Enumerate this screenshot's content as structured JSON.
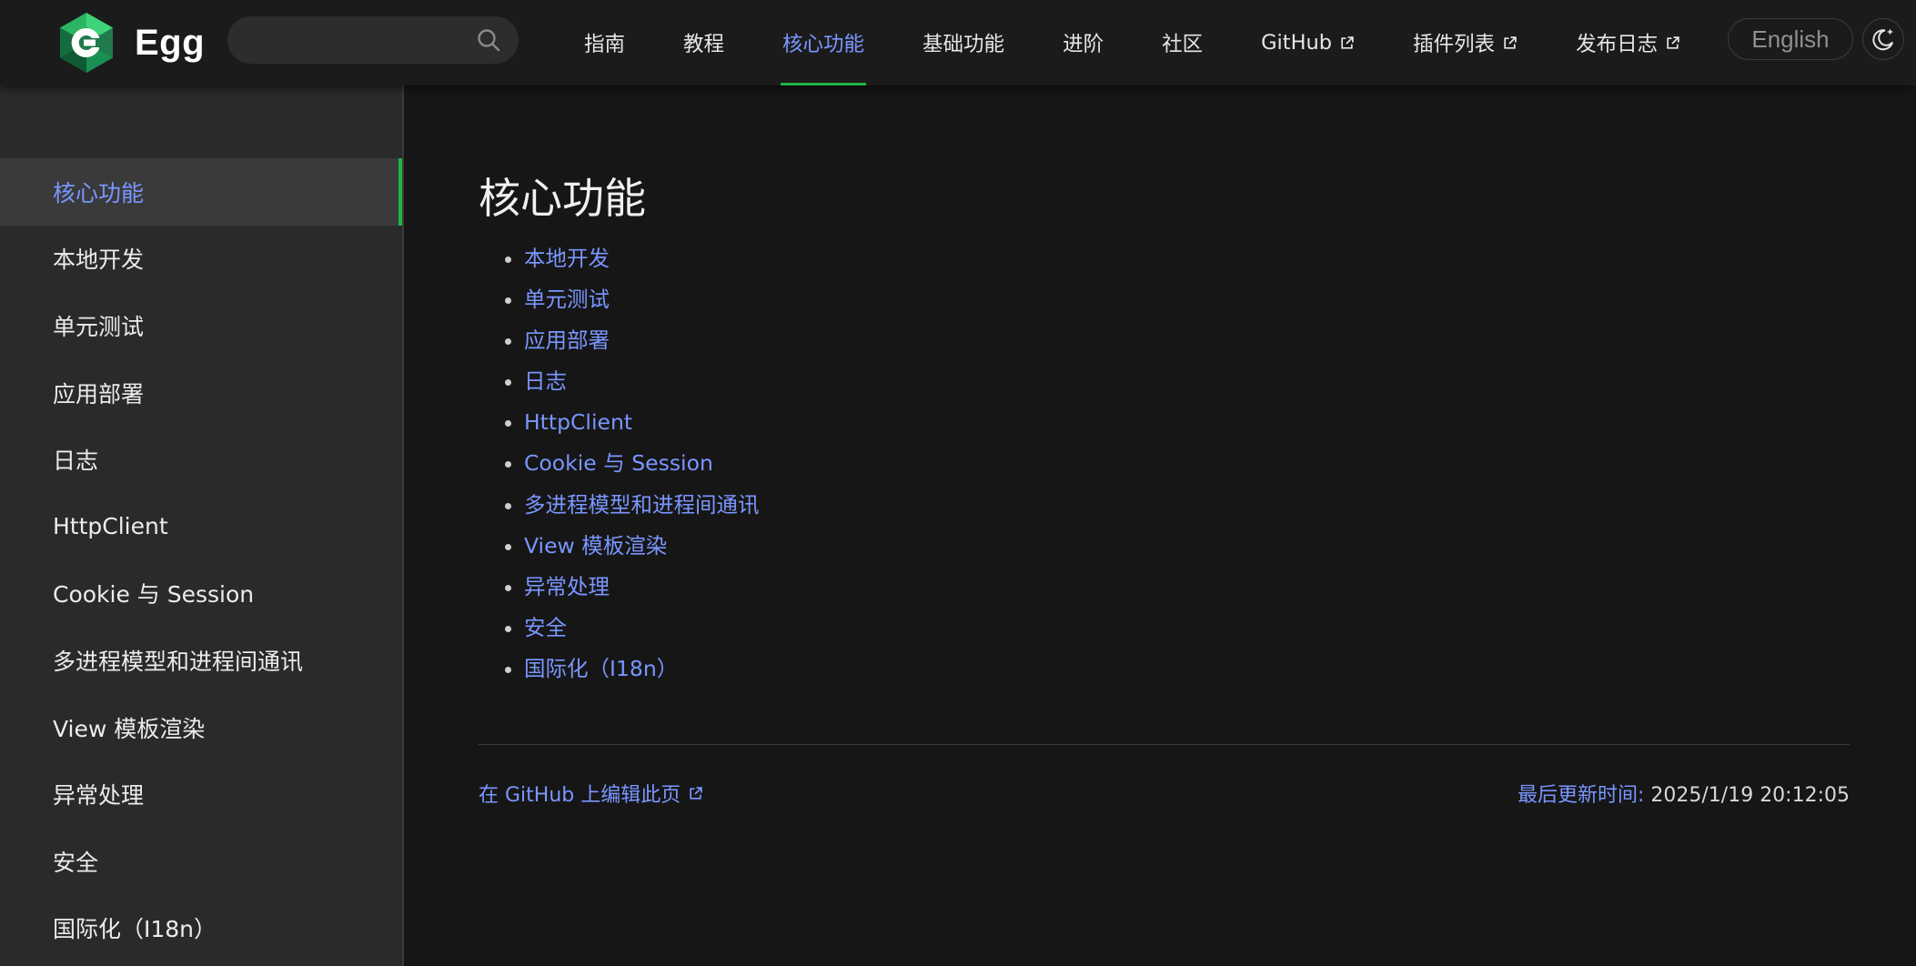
{
  "brand": {
    "name": "Egg"
  },
  "search": {
    "placeholder": ""
  },
  "nav": {
    "items": [
      {
        "label": "指南",
        "external": false,
        "active": false
      },
      {
        "label": "教程",
        "external": false,
        "active": false
      },
      {
        "label": "核心功能",
        "external": false,
        "active": true
      },
      {
        "label": "基础功能",
        "external": false,
        "active": false
      },
      {
        "label": "进阶",
        "external": false,
        "active": false
      },
      {
        "label": "社区",
        "external": false,
        "active": false
      },
      {
        "label": "GitHub",
        "external": true,
        "active": false
      },
      {
        "label": "插件列表",
        "external": true,
        "active": false
      },
      {
        "label": "发布日志",
        "external": true,
        "active": false
      }
    ],
    "language_label": "English"
  },
  "sidebar": {
    "items": [
      {
        "label": "核心功能",
        "active": true
      },
      {
        "label": "本地开发",
        "active": false
      },
      {
        "label": "单元测试",
        "active": false
      },
      {
        "label": "应用部署",
        "active": false
      },
      {
        "label": "日志",
        "active": false
      },
      {
        "label": "HttpClient",
        "active": false
      },
      {
        "label": "Cookie 与 Session",
        "active": false
      },
      {
        "label": "多进程模型和进程间通讯",
        "active": false
      },
      {
        "label": "View 模板渲染",
        "active": false
      },
      {
        "label": "异常处理",
        "active": false
      },
      {
        "label": "安全",
        "active": false
      },
      {
        "label": "国际化（I18n）",
        "active": false
      }
    ]
  },
  "main": {
    "title": "核心功能",
    "toc": [
      "本地开发",
      "单元测试",
      "应用部署",
      "日志",
      "HttpClient",
      "Cookie 与 Session",
      "多进程模型和进程间通讯",
      "View 模板渲染",
      "异常处理",
      "安全",
      "国际化（I18n）"
    ],
    "edit_link": "在 GitHub 上编辑此页",
    "last_updated_label": "最后更新时间:",
    "last_updated_value": "2025/1/19 20:12:05"
  },
  "colors": {
    "accent": "#7a96ff",
    "active_indicator": "#21b541",
    "navbar_bg": "#1b1b1b",
    "sidebar_bg": "#2a2a2a",
    "content_bg": "#161616"
  },
  "icons": {
    "logo": "egg-logo-icon",
    "search": "search-icon",
    "external": "external-link-icon",
    "theme": "moon-star-icon"
  }
}
